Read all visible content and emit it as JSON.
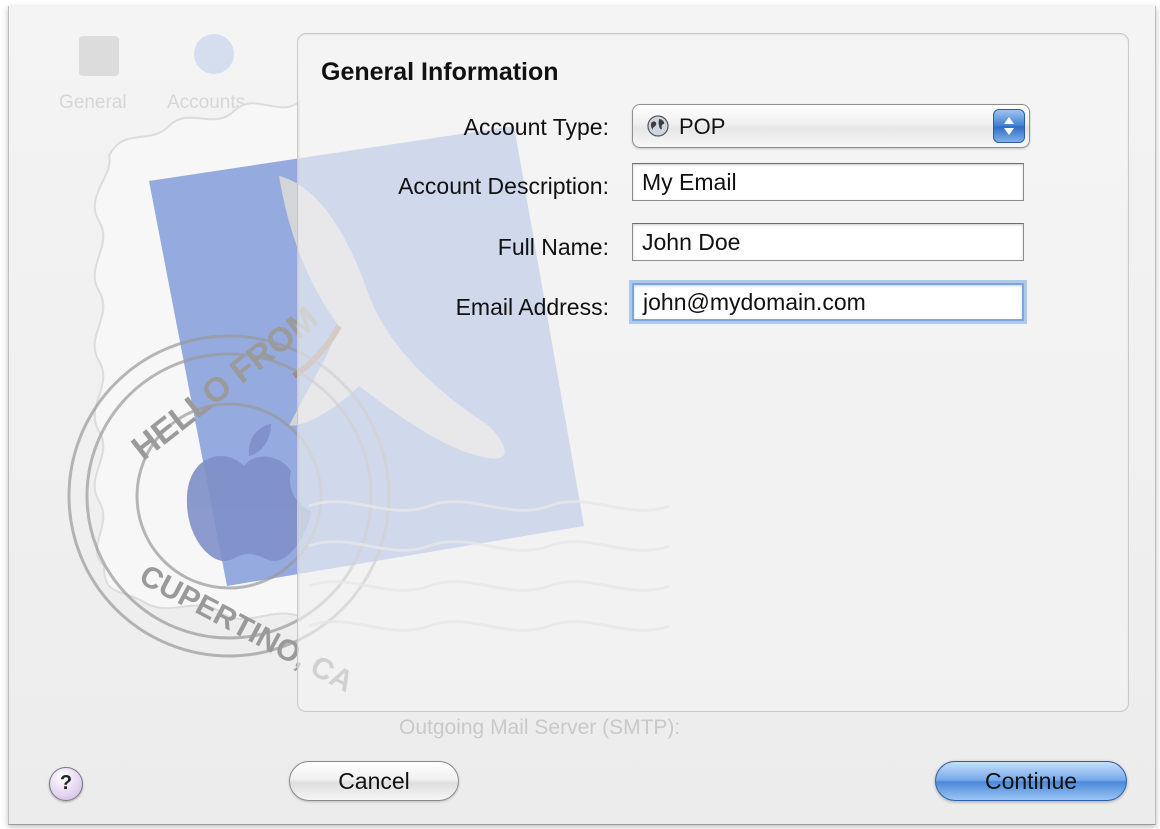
{
  "toolbar": {
    "ghost_tabs": [
      "General",
      "Accounts"
    ]
  },
  "stamp": {
    "top_text": "HELLO FROM",
    "bottom_text": "CUPERTINO, CA"
  },
  "section": {
    "title": "General Information"
  },
  "form": {
    "account_type": {
      "label": "Account Type:",
      "value": "POP",
      "icon": "globe-icon"
    },
    "account_description": {
      "label": "Account Description:",
      "value": "My Email"
    },
    "full_name": {
      "label": "Full Name:",
      "value": "John Doe"
    },
    "email_address": {
      "label": "Email Address:",
      "value": "john@mydomain.com"
    }
  },
  "background_text": {
    "smtp": "Outgoing Mail Server (SMTP):"
  },
  "buttons": {
    "help": "?",
    "cancel": "Cancel",
    "continue": "Continue"
  },
  "colors": {
    "accent": "#4a88d8",
    "stamp_blue": "#8fa5dd"
  }
}
